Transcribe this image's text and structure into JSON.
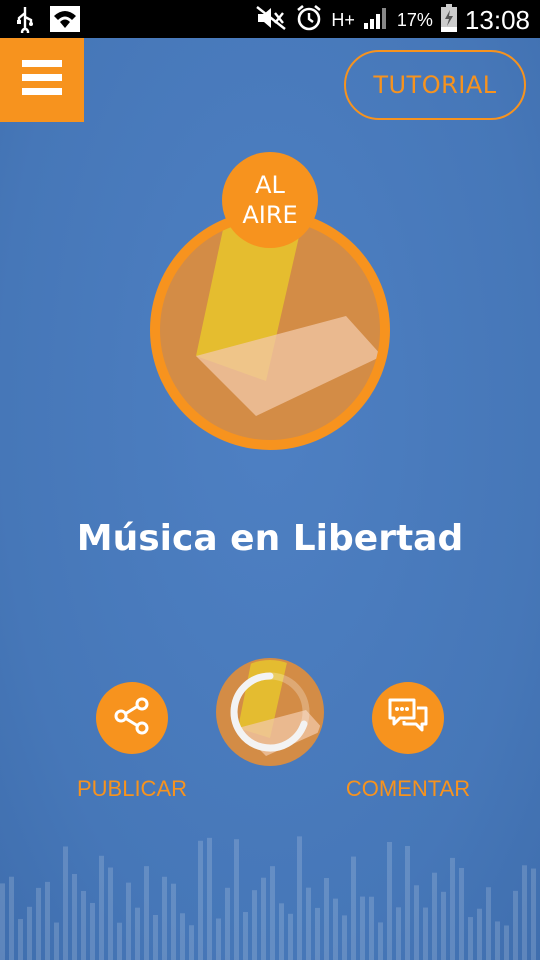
{
  "statusbar": {
    "battery": "17%",
    "time": "13:08",
    "network": "H+",
    "icons": [
      "usb-icon",
      "wifi-icon",
      "mute-icon",
      "alarm-icon",
      "signal-icon",
      "battery-icon"
    ]
  },
  "header": {
    "menu_icon": "hamburger-icon",
    "tutorial_label": "TUTORIAL"
  },
  "station": {
    "badge_line1": "AL",
    "badge_line2": "AIRE",
    "name": "Música en Libertad"
  },
  "actions": {
    "share_label": "PUBLICAR",
    "share_icon": "share-icon",
    "comment_label": "COMENTAR",
    "comment_icon": "chat-bubbles-icon"
  },
  "colors": {
    "accent": "#f7931e",
    "background": "#4a7bbd",
    "logo_yellow": "#e6c12e",
    "logo_light": "#f1c8a8"
  }
}
